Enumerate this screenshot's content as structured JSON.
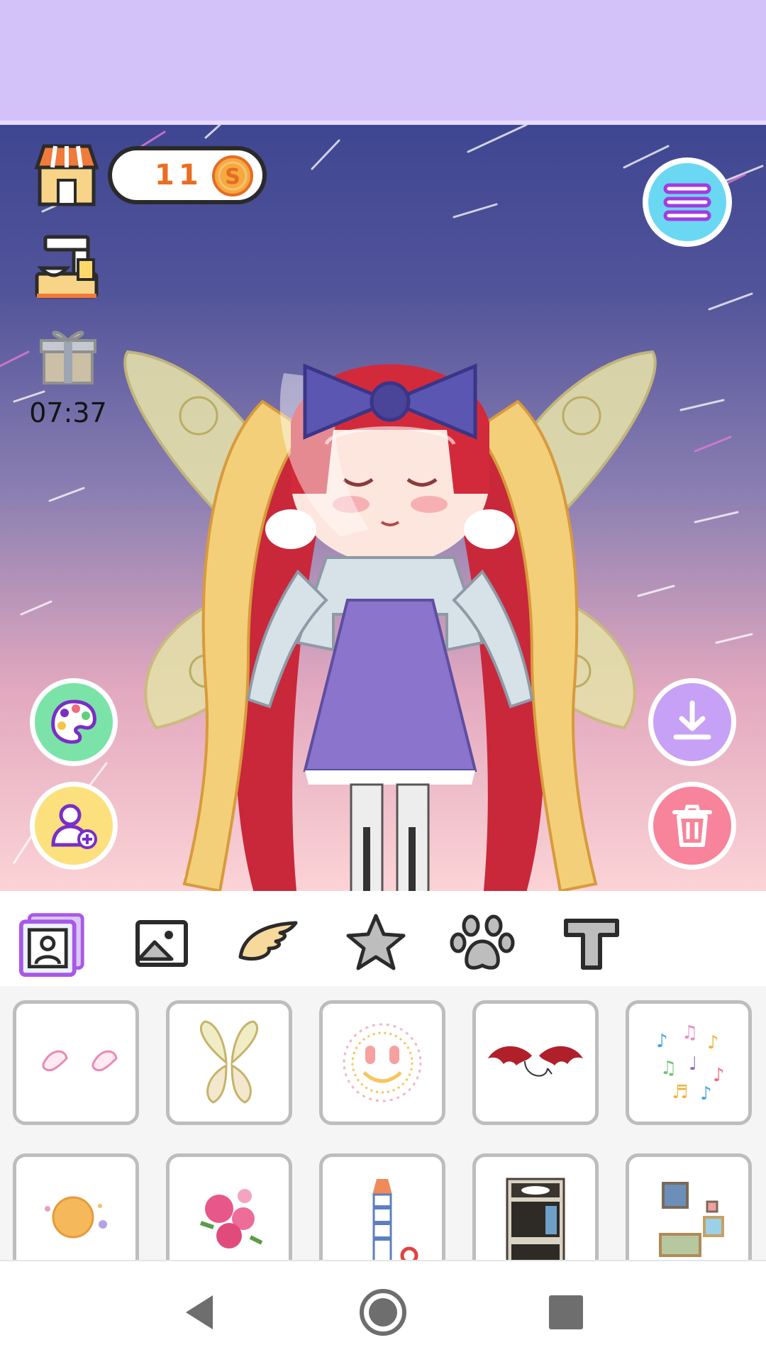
{
  "hud": {
    "coin_count": "11",
    "coin_symbol": "S",
    "timer": "07:37"
  },
  "icons": {
    "shop": "shop-icon",
    "coin": "coin-icon",
    "machine": "vending-machine-icon",
    "gift": "gift-icon",
    "menu": "menu-icon",
    "palette": "palette-icon",
    "add_character": "add-person-icon",
    "download": "download-icon",
    "delete": "trash-icon"
  },
  "tabs": [
    {
      "name": "background-photo",
      "icon": "photo-frame-icon",
      "selected": true
    },
    {
      "name": "image",
      "icon": "image-icon",
      "selected": false
    },
    {
      "name": "wing",
      "icon": "wing-icon",
      "selected": false
    },
    {
      "name": "star",
      "icon": "star-icon",
      "selected": false
    },
    {
      "name": "pet",
      "icon": "paw-icon",
      "selected": false
    },
    {
      "name": "text",
      "icon": "text-icon",
      "selected": false
    }
  ],
  "items": [
    {
      "name": "item-angel-wings"
    },
    {
      "name": "item-fairy-wings"
    },
    {
      "name": "item-smiley-halo"
    },
    {
      "name": "item-bat-wings"
    },
    {
      "name": "item-music-notes"
    },
    {
      "name": "item-planet"
    },
    {
      "name": "item-roses"
    },
    {
      "name": "item-lighthouse"
    },
    {
      "name": "item-shelf"
    },
    {
      "name": "item-picture-frames"
    }
  ],
  "colors": {
    "banner": "#d3c1fa",
    "coin_text": "#e96d22",
    "menu": "#6ad8f2",
    "palette": "#7be3a7",
    "add_character": "#fbe07d",
    "download": "#c7a1f5",
    "delete": "#f7849a",
    "tab_selected": "#a858e8"
  }
}
